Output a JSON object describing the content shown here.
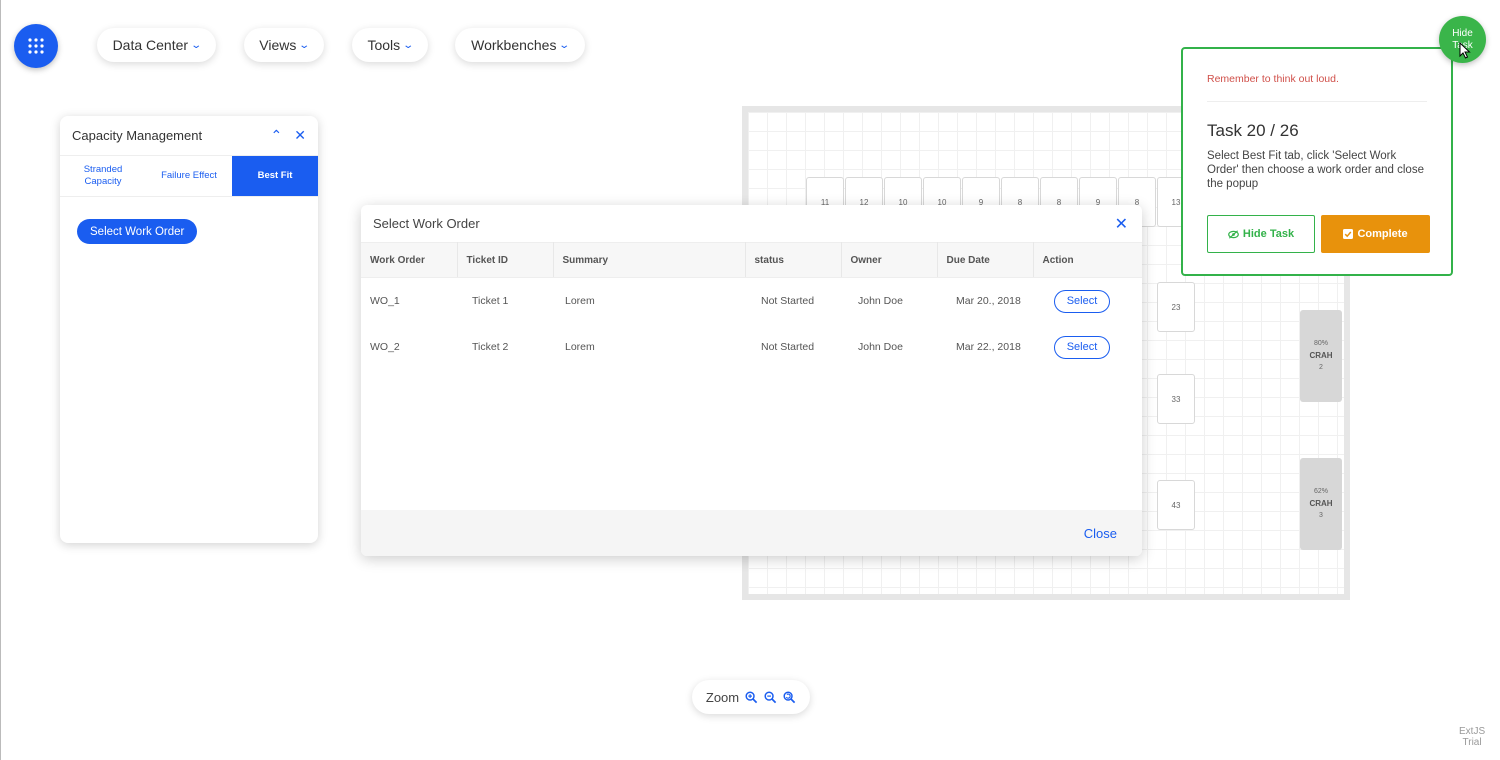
{
  "nav": {
    "apps_icon": "grid-icon",
    "items": [
      {
        "label": "Data Center"
      },
      {
        "label": "Views"
      },
      {
        "label": "Tools"
      },
      {
        "label": "Workbenches"
      }
    ]
  },
  "floor": {
    "racks_top": [
      "11",
      "12",
      "10",
      "10",
      "9",
      "8",
      "8",
      "9",
      "8",
      "13"
    ],
    "racks_side": [
      "23",
      "33",
      "43"
    ],
    "crah": [
      {
        "pct": "80%",
        "label": "CRAH",
        "num": "2"
      },
      {
        "pct": "62%",
        "label": "CRAH",
        "num": "3"
      }
    ]
  },
  "capacity_panel": {
    "title": "Capacity Management",
    "tabs": [
      {
        "label": "Stranded Capacity",
        "active": false
      },
      {
        "label": "Failure Effect",
        "active": false
      },
      {
        "label": "Best Fit",
        "active": true
      }
    ],
    "select_button": "Select Work Order"
  },
  "modal": {
    "title": "Select Work Order",
    "columns": [
      "Work Order",
      "Ticket ID",
      "Summary",
      "status",
      "Owner",
      "Due Date",
      "Action"
    ],
    "rows": [
      {
        "work_order": "WO_1",
        "ticket": "Ticket 1",
        "summary": "Lorem",
        "status": "Not Started",
        "owner": "John Doe",
        "due": "Mar 20., 2018",
        "action": "Select"
      },
      {
        "work_order": "WO_2",
        "ticket": "Ticket 2",
        "summary": "Lorem",
        "status": "Not Started",
        "owner": "John Doe",
        "due": "Mar 22., 2018",
        "action": "Select"
      }
    ],
    "close_label": "Close"
  },
  "task": {
    "reminder": "Remember to think out loud.",
    "title": "Task 20 / 26",
    "description": "Select Best Fit tab, click 'Select Work Order' then choose a work order and close the popup",
    "hide_label": "Hide Task",
    "complete_label": "Complete",
    "circle_line1": "Hide",
    "circle_line2": "Task"
  },
  "zoom": {
    "label": "Zoom"
  },
  "watermark": {
    "line1": "ExtJS",
    "line2": "Trial"
  },
  "colors": {
    "primary": "#1a5df0",
    "success": "#33b24a",
    "warning": "#e8920c",
    "danger": "#d0504a"
  }
}
